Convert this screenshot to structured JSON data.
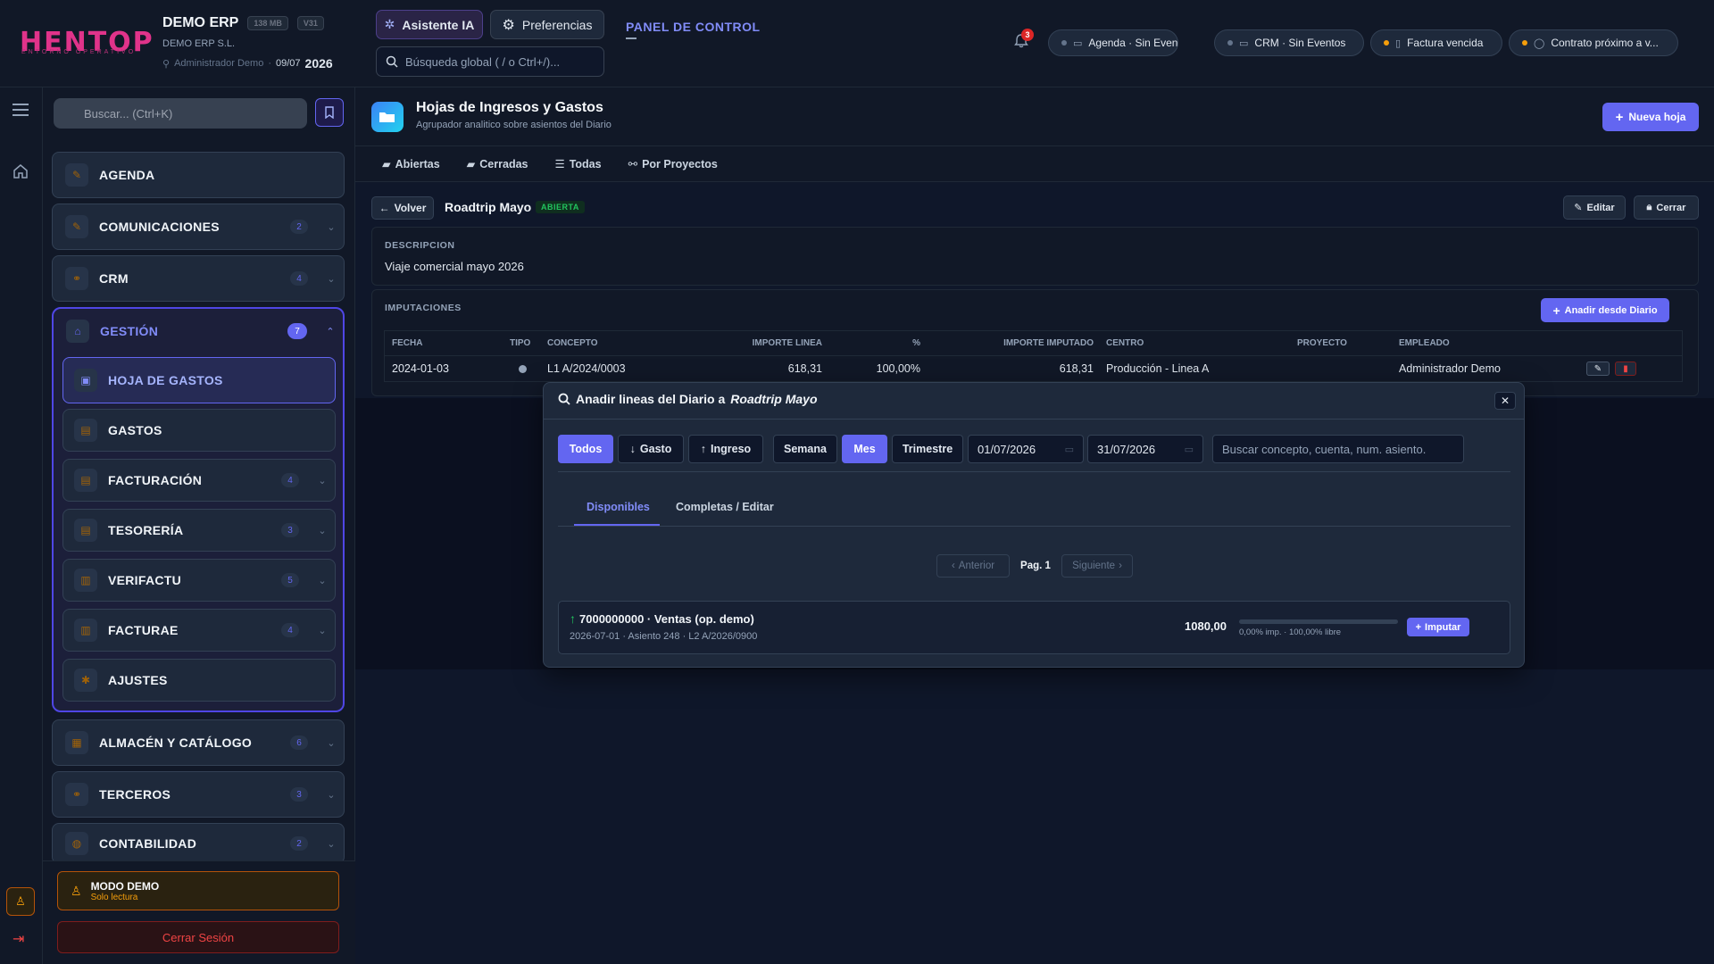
{
  "header": {
    "logo_text": "HENTOP",
    "logo_sub": "ENTORNO OPERATIVO",
    "company": "DEMO ERP",
    "chip_mem": "138 MB",
    "chip_ver": "V31",
    "company_sub": "DEMO ERP S.L.",
    "user": "Administrador Demo",
    "date": "09/07",
    "year": "2026",
    "ai_label": "Asistente IA",
    "prefs_label": "Preferencias",
    "search_placeholder": "Búsqueda global ( / o Ctrl+/)...",
    "panel_label": "PANEL DE CONTROL",
    "bell_count": "3",
    "notifications": [
      {
        "label": "Agenda · Sin Eventos",
        "dot": "#64748b"
      },
      {
        "label": "CRM · Sin Eventos",
        "dot": "#64748b"
      },
      {
        "label": "Factura vencida",
        "dot": "#f59e0b"
      },
      {
        "label": "Contrato próximo a v...",
        "dot": "#f59e0b"
      }
    ]
  },
  "sidebar": {
    "search_placeholder": "Buscar... (Ctrl+K)",
    "items": [
      {
        "label": "AGENDA",
        "badge": ""
      },
      {
        "label": "COMUNICACIONES",
        "badge": "2"
      },
      {
        "label": "CRM",
        "badge": "4"
      },
      {
        "label": "GESTIÓN",
        "badge": "7"
      },
      {
        "label": "ALMACÉN Y CATÁLOGO",
        "badge": "6"
      },
      {
        "label": "TERCEROS",
        "badge": "3"
      },
      {
        "label": "CONTABILIDAD",
        "badge": "2"
      }
    ],
    "gestion_sub": [
      {
        "label": "HOJA DE GASTOS",
        "badge": ""
      },
      {
        "label": "GASTOS",
        "badge": ""
      },
      {
        "label": "FACTURACIÓN",
        "badge": "4"
      },
      {
        "label": "TESORERÍA",
        "badge": "3"
      },
      {
        "label": "VERIFACTU",
        "badge": "5"
      },
      {
        "label": "FACTURAE",
        "badge": "4"
      },
      {
        "label": "AJUSTES",
        "badge": ""
      }
    ],
    "demo_title": "MODO DEMO",
    "demo_sub": "Solo lectura",
    "logout": "Cerrar Sesión"
  },
  "page": {
    "title": "Hojas de Ingresos y Gastos",
    "subtitle": "Agrupador analitico sobre asientos del Diario",
    "new_button": "Nueva hoja",
    "tabs": [
      "Abiertas",
      "Cerradas",
      "Todas",
      "Por Proyectos"
    ],
    "back": "Volver",
    "sheet_name": "Roadtrip Mayo",
    "sheet_status": "ABIERTA",
    "edit": "Editar",
    "close": "Cerrar",
    "desc_label": "DESCRIPCION",
    "desc_value": "Viaje comercial mayo 2026",
    "imp_label": "IMPUTACIONES",
    "add_from_diario": "Anadir desde Diario",
    "columns": [
      "FECHA",
      "TIPO",
      "CONCEPTO",
      "IMPORTE LINEA",
      "%",
      "IMPORTE IMPUTADO",
      "CENTRO",
      "PROYECTO",
      "EMPLEADO"
    ],
    "rows": [
      {
        "fecha": "2024-01-03",
        "concepto": "L1 A/2024/0003",
        "importe_linea": "618,31",
        "pct": "100,00%",
        "importe_imputado": "618,31",
        "centro": "Producción - Linea A",
        "proyecto": "",
        "empleado": "Administrador Demo"
      }
    ]
  },
  "modal": {
    "title_prefix": "Anadir lineas del Diario a",
    "title_sheet": "Roadtrip Mayo",
    "filters": [
      "Todos",
      "Gasto",
      "Ingreso"
    ],
    "periods": [
      "Semana",
      "Mes",
      "Trimestre"
    ],
    "date_from": "01/07/2026",
    "date_to": "31/07/2026",
    "search_placeholder": "Buscar concepto, cuenta, num. asiento.",
    "tab_available": "Disponibles",
    "tab_complete": "Completas / Editar",
    "prev": "Anterior",
    "page_label": "Pag. 1",
    "next": "Siguiente",
    "entry": {
      "account": "7000000000 · Ventas (op. demo)",
      "meta": "2026-07-01 · Asiento 248 · L2 A/2026/0900",
      "amount": "1080,00",
      "imputed_pct": 0,
      "progress_text": "0,00% imp. · 100,00% libre",
      "button": "Imputar"
    }
  }
}
